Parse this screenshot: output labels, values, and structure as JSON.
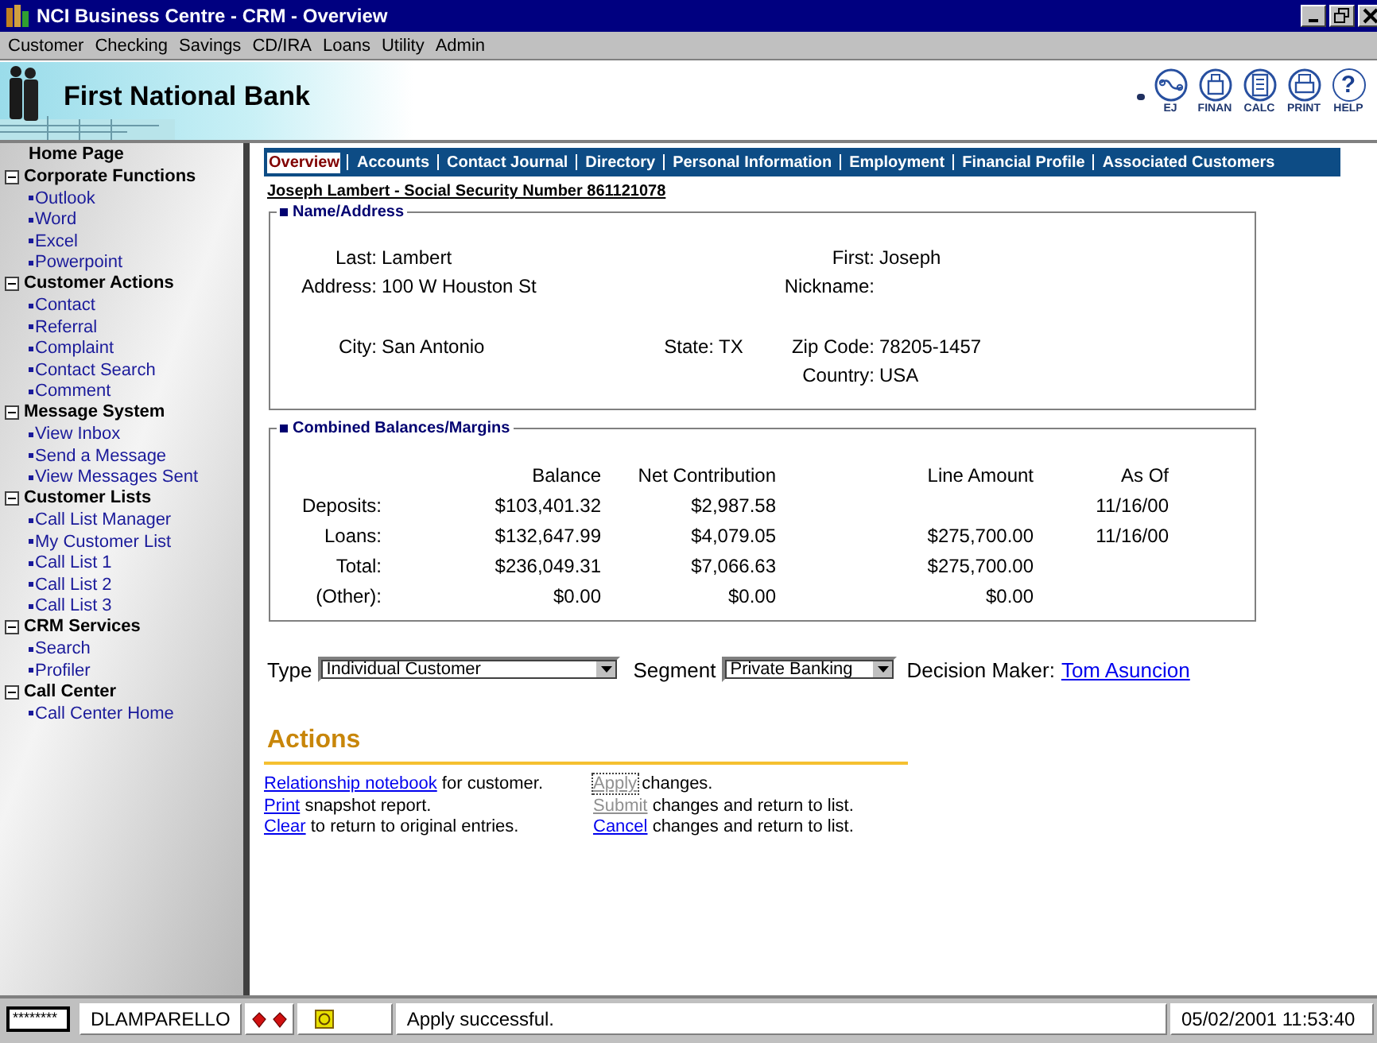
{
  "window": {
    "title": "NCI Business Centre  -  CRM - Overview"
  },
  "menu": [
    "Customer",
    "Checking",
    "Savings",
    "CD/IRA",
    "Loans",
    "Utility",
    "Admin"
  ],
  "header": {
    "bank_name": "First National Bank",
    "tools": [
      {
        "kind": "link",
        "label": "EJ"
      },
      {
        "kind": "finance",
        "label": "FINAN"
      },
      {
        "kind": "calc",
        "label": "CALC"
      },
      {
        "kind": "print",
        "label": "PRINT"
      },
      {
        "kind": "help",
        "label": "HELP",
        "glyph": "?"
      }
    ]
  },
  "sidebar": {
    "items": [
      {
        "kind": "home",
        "label": "Home Page"
      },
      {
        "kind": "section",
        "label": "Corporate Functions",
        "expanded": true,
        "children": [
          {
            "label": "Outlook"
          },
          {
            "label": "Word"
          },
          {
            "label": "Excel"
          },
          {
            "label": "Powerpoint"
          }
        ]
      },
      {
        "kind": "section",
        "label": "Customer Actions",
        "expanded": true,
        "children": [
          {
            "label": "Contact"
          },
          {
            "label": "Referral"
          },
          {
            "label": "Complaint"
          },
          {
            "label": "Contact Search"
          },
          {
            "label": "Comment"
          }
        ]
      },
      {
        "kind": "section",
        "label": "Message System",
        "expanded": true,
        "children": [
          {
            "label": "View Inbox"
          },
          {
            "label": "Send a Message"
          },
          {
            "label": "View Messages Sent"
          }
        ]
      },
      {
        "kind": "section",
        "label": "Customer Lists",
        "expanded": true,
        "children": [
          {
            "label": "Call List Manager"
          },
          {
            "label": "My Customer List"
          },
          {
            "label": "Call List 1"
          },
          {
            "label": "Call List 2"
          },
          {
            "label": "Call List 3"
          }
        ]
      },
      {
        "kind": "section",
        "label": "CRM Services",
        "expanded": true,
        "children": [
          {
            "label": "Search"
          },
          {
            "label": "Profiler"
          }
        ]
      },
      {
        "kind": "section",
        "label": "Call Center",
        "expanded": true,
        "children": [
          {
            "label": "Call Center Home"
          }
        ]
      }
    ]
  },
  "tabs": [
    {
      "label": "Overview",
      "selected": true
    },
    {
      "label": "Accounts",
      "selected": false
    },
    {
      "label": "Contact Journal",
      "selected": false
    },
    {
      "label": "Directory",
      "selected": false
    },
    {
      "label": "Personal Information",
      "selected": false
    },
    {
      "label": "Employment",
      "selected": false
    },
    {
      "label": "Financial Profile",
      "selected": false
    },
    {
      "label": "Associated Customers",
      "selected": false
    }
  ],
  "customer_heading": "Joseph Lambert - Social Security Number 861121078",
  "name_address": {
    "title": "Name/Address",
    "fields": [
      {
        "label": "Last:",
        "value": "Lambert"
      },
      {
        "label": "First:",
        "value": "Joseph"
      },
      {
        "label": "Address:",
        "value": "100 W Houston St"
      },
      {
        "label": "Nickname:"
      },
      {
        "label": "City:",
        "value": "San Antonio"
      },
      {
        "label": "State:",
        "value": "TX"
      },
      {
        "label": "Zip Code:",
        "value": "78205-1457"
      },
      {
        "label": "Country:",
        "value": "USA"
      }
    ]
  },
  "balances": {
    "title": "Combined Balances/Margins",
    "columns": [
      "Balance",
      "Net Contribution",
      "Line Amount",
      "As Of"
    ],
    "rows": [
      {
        "label": "Deposits:",
        "balance": "$103,401.32",
        "net_contribution": "$2,987.58",
        "as_of": "11/16/00"
      },
      {
        "label": "Loans:",
        "balance": "$132,647.99",
        "net_contribution": "$4,079.05",
        "line_amount": "$275,700.00",
        "as_of": "11/16/00"
      },
      {
        "label": "Total:",
        "balance": "$236,049.31",
        "net_contribution": "$7,066.63",
        "line_amount": "$275,700.00"
      },
      {
        "label": "(Other):",
        "balance": "$0.00",
        "net_contribution": "$0.00",
        "line_amount": "$0.00"
      }
    ]
  },
  "classification": {
    "type_label": "Type",
    "type_value": "Individual Customer",
    "segment_label": "Segment",
    "segment_value": "Private Banking",
    "decision_maker_label": "Decision Maker:",
    "decision_maker": "Tom Asuncion"
  },
  "actions": {
    "title": "Actions",
    "left": [
      {
        "link": "Relationship notebook",
        "text": "for customer.",
        "disabled": false,
        "focused": false
      },
      {
        "link": "Print",
        "text": "snapshot report.",
        "disabled": false,
        "focused": false
      },
      {
        "link": "Clear",
        "text": "to return to original entries.",
        "disabled": false,
        "focused": false
      }
    ],
    "right": [
      {
        "link": "Apply",
        "text": "changes.",
        "disabled": true,
        "focused": true
      },
      {
        "link": "Submit",
        "text": "changes and return to list.",
        "disabled": true,
        "focused": false
      },
      {
        "link": "Cancel",
        "text": "changes and return to list.",
        "disabled": false,
        "focused": false
      }
    ]
  },
  "status_bar": {
    "password": "********",
    "user": "DLAMPARELLO",
    "message": "Apply successful.",
    "datetime": "05/02/2001 11:53:40"
  }
}
